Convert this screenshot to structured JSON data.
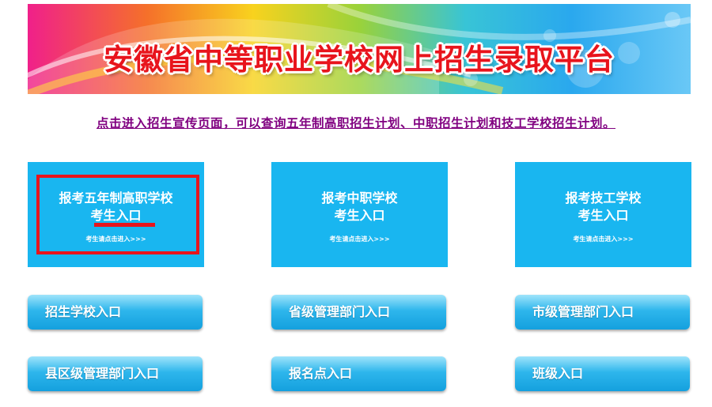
{
  "banner": {
    "title": "安徽省中等职业学校网上招生录取平台"
  },
  "promo_link": "点击进入招生宣传页面，可以查询五年制高职招生计划、中职招生计划和技工学校招生计划。",
  "entry_cards": [
    {
      "line1": "报考五年制高职学校",
      "line2": "考生入口",
      "hint": "考生请点击进入>>>"
    },
    {
      "line1": "报考中职学校",
      "line2": "考生入口",
      "hint": "考生请点击进入>>>"
    },
    {
      "line1": "报考技工学校",
      "line2": "考生入口",
      "hint": "考生请点击进入>>>"
    }
  ],
  "portal_buttons": [
    "招生学校入口",
    "省级管理部门入口",
    "市级管理部门入口",
    "县区级管理部门入口",
    "报名点入口",
    "班级入口"
  ],
  "colors": {
    "accent": "#19b6f0",
    "title_red": "#e8141c",
    "link_purple": "#800080"
  }
}
